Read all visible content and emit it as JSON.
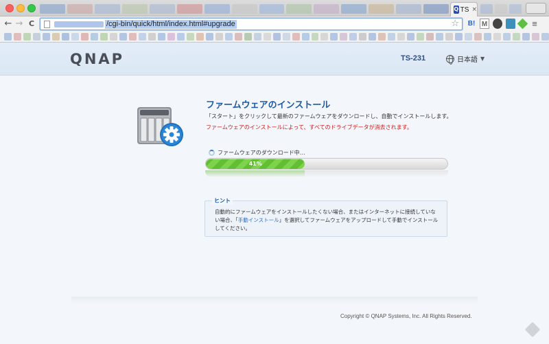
{
  "browser": {
    "active_tab_title": "TS",
    "tab_close": "×",
    "url": "/cgi-bin/quick/html/index.html#upgrade",
    "nav_back": "←",
    "nav_forward": "→",
    "nav_reload": "C",
    "bookmark_star": "☆",
    "ext_labels": [
      "B!",
      "M",
      "",
      "",
      "",
      "≡"
    ]
  },
  "header": {
    "logo": "QNAP",
    "model": "TS-231",
    "language": "日本語",
    "language_caret": "▼"
  },
  "main": {
    "title": "ファームウェアのインストール",
    "description": "「スタート」をクリックして最新のファームウェアをダウンロードし、自動でインストールします。",
    "warning": "ファームウェアのインストールによって、すべてのドライブデータが消去されます。",
    "download_status": "ファームウェアのダウンロード中…",
    "progress": {
      "percent": 41,
      "label": "41%"
    }
  },
  "hint": {
    "title": "ヒント",
    "text_before": "自動的にファームウェアをインストールしたくない場合、またはインターネットに接続していない場合、「",
    "link": "手動インストール",
    "text_after": "」を選択してファームウェアをアップロードして手動でインストールしてください。"
  },
  "footer": {
    "copyright": "Copyright © QNAP Systems, Inc. All Rights Reserved."
  },
  "colors": {
    "accent": "#1f5aa3",
    "warning": "#cc1b1b",
    "progress": "#6fca3e"
  }
}
